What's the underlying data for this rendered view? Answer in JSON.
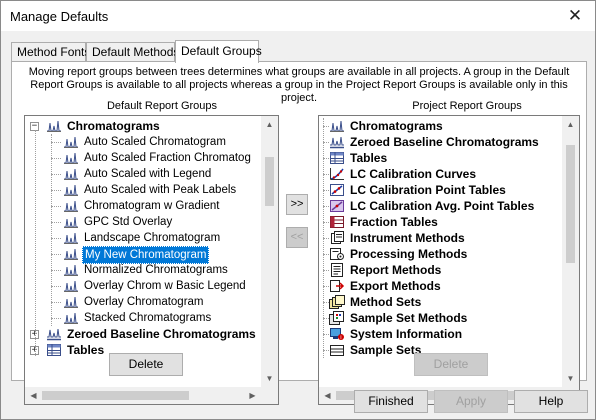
{
  "window": {
    "title": "Manage Defaults",
    "close_glyph": "✕"
  },
  "tabs": [
    {
      "label": "Method Fonts",
      "active": false
    },
    {
      "label": "Default Methods",
      "active": false
    },
    {
      "label": "Default Groups",
      "active": true
    }
  ],
  "description": "Moving report groups between trees determines what groups are available in all projects. A group in the Default Report Groups is available to all projects whereas a group in the Project Report Groups is available only in this project.",
  "left_panel": {
    "label": "Default Report Groups",
    "items": [
      {
        "label": "Chromatograms",
        "bold": true,
        "level": 0,
        "expander": "−",
        "icon": "chromatogram-icon"
      },
      {
        "label": "Auto Scaled Chromatogram",
        "level": 1,
        "icon": "chromatogram-icon"
      },
      {
        "label": "Auto Scaled Fraction Chromatog",
        "level": 1,
        "icon": "chromatogram-icon"
      },
      {
        "label": "Auto Scaled with Legend",
        "level": 1,
        "icon": "chromatogram-icon"
      },
      {
        "label": "Auto Scaled with Peak Labels",
        "level": 1,
        "icon": "chromatogram-icon"
      },
      {
        "label": "Chromatogram w Gradient",
        "level": 1,
        "icon": "chromatogram-icon"
      },
      {
        "label": "GPC Std Overlay",
        "level": 1,
        "icon": "chromatogram-icon"
      },
      {
        "label": "Landscape Chromatogram",
        "level": 1,
        "icon": "chromatogram-icon"
      },
      {
        "label": "My New Chromatogram",
        "level": 1,
        "icon": "chromatogram-icon",
        "selected": true
      },
      {
        "label": "Normalized Chromatograms",
        "level": 1,
        "icon": "chromatogram-icon"
      },
      {
        "label": "Overlay Chrom w Basic Legend",
        "level": 1,
        "icon": "chromatogram-icon"
      },
      {
        "label": "Overlay Chromatogram",
        "level": 1,
        "icon": "chromatogram-icon"
      },
      {
        "label": "Stacked Chromatograms",
        "level": 1,
        "icon": "chromatogram-icon"
      },
      {
        "label": "Zeroed Baseline Chromatograms",
        "bold": true,
        "level": 0,
        "expander": "+",
        "icon": "zeroed-baseline-icon"
      },
      {
        "label": "Tables",
        "bold": true,
        "level": 0,
        "expander": "+",
        "icon": "table-icon"
      }
    ],
    "delete_label": "Delete",
    "vthumb": [
      0.1,
      0.31
    ],
    "hthumb": [
      0.0,
      0.73
    ]
  },
  "move_right_label": ">>",
  "move_left_label": "<<",
  "right_panel": {
    "label": "Project Report Groups",
    "items": [
      {
        "label": "Chromatograms",
        "icon": "chromatogram-icon"
      },
      {
        "label": "Zeroed Baseline Chromatograms",
        "icon": "zeroed-baseline-icon"
      },
      {
        "label": "Tables",
        "icon": "table-icon"
      },
      {
        "label": "LC Calibration Curves",
        "icon": "calibration-curve-icon"
      },
      {
        "label": "LC Calibration Point Tables",
        "icon": "calibration-point-icon"
      },
      {
        "label": "LC Calibration Avg. Point Tables",
        "icon": "calibration-avg-icon"
      },
      {
        "label": "Fraction Tables",
        "icon": "fraction-table-icon"
      },
      {
        "label": "Instrument Methods",
        "icon": "instrument-method-icon"
      },
      {
        "label": "Processing Methods",
        "icon": "processing-method-icon"
      },
      {
        "label": "Report Methods",
        "icon": "report-method-icon"
      },
      {
        "label": "Export Methods",
        "icon": "export-method-icon"
      },
      {
        "label": "Method Sets",
        "icon": "method-set-icon"
      },
      {
        "label": "Sample Set Methods",
        "icon": "sample-set-method-icon"
      },
      {
        "label": "System Information",
        "icon": "system-info-icon"
      },
      {
        "label": "Sample Sets",
        "icon": "sample-set-icon"
      }
    ],
    "delete_label": "Delete",
    "vthumb": [
      0.05,
      0.55
    ],
    "hthumb": [
      0.0,
      0.93
    ]
  },
  "footer": {
    "finished_label": "Finished",
    "apply_label": "Apply",
    "help_label": "Help"
  }
}
